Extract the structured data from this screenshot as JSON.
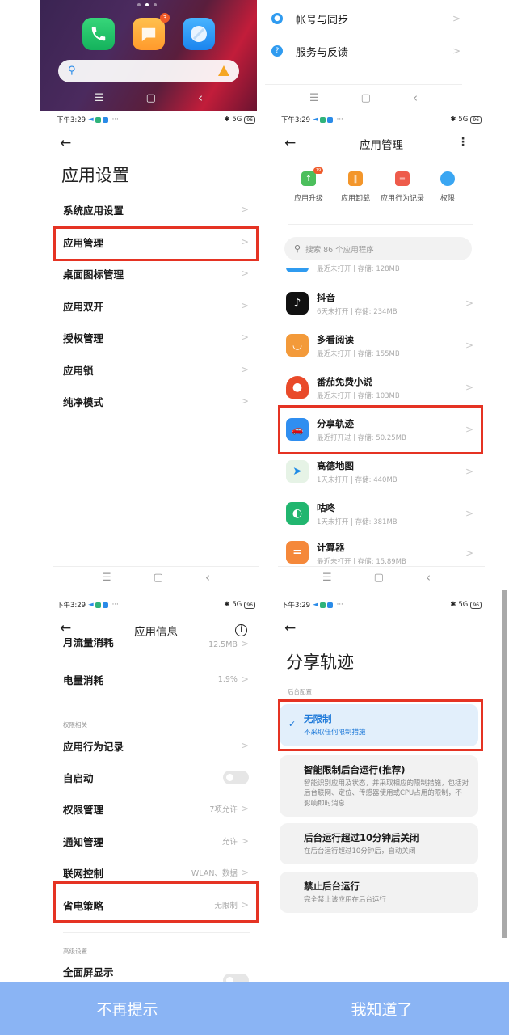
{
  "home_screen": {
    "apps": [
      {
        "name": "phone",
        "icon": "phone-icon"
      },
      {
        "name": "messages",
        "icon": "message-icon",
        "badge": "3"
      },
      {
        "name": "browser",
        "icon": "browser-icon"
      }
    ],
    "search_icon": "Q"
  },
  "nav": {
    "menu": "☰",
    "home": "▢",
    "back": "‹"
  },
  "top_right_list": {
    "items": [
      {
        "label": "帐号与同步",
        "icon": "account-icon"
      },
      {
        "label": "服务与反馈",
        "icon": "help-icon"
      }
    ]
  },
  "status_bar": {
    "time": "下午3:29",
    "dots": "···",
    "signal": "5G",
    "battery": "96"
  },
  "app_settings": {
    "back": "←",
    "title": "应用设置",
    "items": [
      {
        "label": "系统应用设置"
      },
      {
        "label": "应用管理",
        "highlighted": true
      },
      {
        "label": "桌面图标管理"
      },
      {
        "label": "应用双开"
      },
      {
        "label": "授权管理"
      },
      {
        "label": "应用锁"
      },
      {
        "label": "纯净模式"
      }
    ]
  },
  "app_manager": {
    "back": "←",
    "title": "应用管理",
    "more": "⋮",
    "quick_actions": [
      {
        "label": "应用升级",
        "color": "#4cbf5c",
        "badge": "19"
      },
      {
        "label": "应用卸载",
        "color": "#f3962b"
      },
      {
        "label": "应用行为记录",
        "color": "#ee5b4b"
      },
      {
        "label": "权限",
        "color": "#3aa6f2"
      }
    ],
    "search_placeholder": "搜索 86 个应用程序",
    "partial_row_meta": "最近未打开 | 存储: 128MB",
    "apps": [
      {
        "name": "抖音",
        "meta": "6天未打开 | 存储: 234MB",
        "color": "#111111",
        "glyph": "♪"
      },
      {
        "name": "多看阅读",
        "meta": "最近未打开 | 存储: 155MB",
        "color": "#f39a3a",
        "glyph": "◡"
      },
      {
        "name": "番茄免费小说",
        "meta": "最近未打开 | 存储: 103MB",
        "color": "#e94a2a",
        "glyph": "●"
      },
      {
        "name": "分享轨迹",
        "meta": "最近打开过 | 存储: 50.25MB",
        "color": "#2f8ef0",
        "glyph": "🚗",
        "highlighted": true
      },
      {
        "name": "高德地图",
        "meta": "1天未打开 | 存储: 440MB",
        "color": "#1e8be6",
        "glyph": "➤"
      },
      {
        "name": "咕咚",
        "meta": "1天未打开 | 存储: 381MB",
        "color": "#21b66f",
        "glyph": "◐"
      },
      {
        "name": "计算器",
        "meta": "最近未打开 | 存储: 15.89MB",
        "color": "#f5883a",
        "glyph": "="
      }
    ]
  },
  "app_info": {
    "back": "←",
    "title": "应用信息",
    "info": "i",
    "partial_row": {
      "label": "月流量消耗",
      "value": "12.5MB"
    },
    "battery_row": {
      "label": "电量消耗",
      "value": "1.9%"
    },
    "section_permissions": "权限相关",
    "rows": [
      {
        "label": "应用行为记录",
        "value": ""
      },
      {
        "label": "自启动",
        "toggle": false
      },
      {
        "label": "权限管理",
        "value": "7项允许"
      },
      {
        "label": "通知管理",
        "value": "允许"
      },
      {
        "label": "联网控制",
        "value": "WLAN、数据"
      },
      {
        "label": "省电策略",
        "value": "无限制",
        "highlighted": true
      }
    ],
    "section_advanced": "高级设置",
    "fullscreen_row": {
      "label": "全面屏显示",
      "toggle": false
    }
  },
  "battery_policy": {
    "back": "←",
    "title": "分享轨迹",
    "section": "后台配置",
    "options": [
      {
        "title": "无限制",
        "desc": "不采取任何限制措施",
        "selected": true
      },
      {
        "title": "智能限制后台运行(推荐)",
        "desc": "智能识别应用及状态，并采取相应的限制措施，包括对后台联网、定位、传感器使用或CPU占用的限制，不影响即时消息",
        "selected": false
      },
      {
        "title": "后台运行超过10分钟后关闭",
        "desc": "在后台运行超过10分钟后，自动关闭",
        "selected": false
      },
      {
        "title": "禁止后台运行",
        "desc": "完全禁止该应用在后台运行",
        "selected": false
      }
    ]
  },
  "bottom_bar": {
    "dont_remind": "不再提示",
    "got_it": "我知道了",
    "color": "#8ab4f4"
  },
  "accent_red": "#e53323"
}
